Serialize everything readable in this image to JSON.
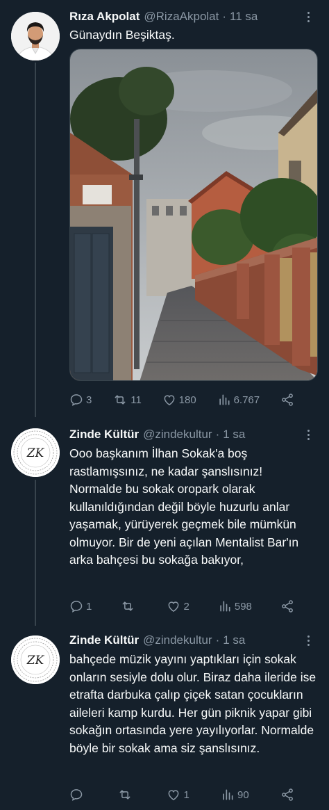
{
  "tweets": [
    {
      "name": "Rıza Akpolat",
      "handle": "@RizaAkpolat",
      "time": "11 sa",
      "text": "Günaydın Beşiktaş.",
      "replies": "3",
      "retweets": "11",
      "likes": "180",
      "views": "6.767"
    },
    {
      "name": "Zinde Kültür",
      "handle": "@zindekultur",
      "time": "1 sa",
      "text": "Ooo başkanım İlhan Sokak'a boş rastlamışsınız, ne kadar şanslısınız! Normalde bu sokak oropark olarak kullanıldığından değil böyle huzurlu anlar yaşamak, yürüyerek geçmek bile mümkün olmuyor. Bir de yeni açılan Mentalist Bar'ın arka bahçesi bu sokağa bakıyor,",
      "replies": "1",
      "retweets": "",
      "likes": "2",
      "views": "598"
    },
    {
      "name": "Zinde Kültür",
      "handle": "@zindekultur",
      "time": "1 sa",
      "text": "bahçede müzik yayını yaptıkları için sokak onların sesiyle dolu olur. Biraz daha ileride ise etrafta darbuka çalıp çiçek satan çocukların aileleri kamp kurdu. Her gün piknik yapar gibi sokağın ortasında yere yayılıyorlar. Normalde böyle bir sokak ama siz şanslısınız.",
      "replies": "",
      "retweets": "",
      "likes": "1",
      "views": "90"
    }
  ],
  "logo": {
    "monogram": "ZK",
    "ring_text": "1923 1923 1923 1923 1923 1923"
  },
  "colors": {
    "background": "#15202b",
    "text": "#f7f9f9",
    "secondary": "#8b98a5",
    "divider": "#38444d"
  },
  "icons": {
    "reply": "reply-icon",
    "retweet": "retweet-icon",
    "like": "like-icon",
    "views": "views-icon",
    "share": "share-icon",
    "more": "more-icon"
  }
}
